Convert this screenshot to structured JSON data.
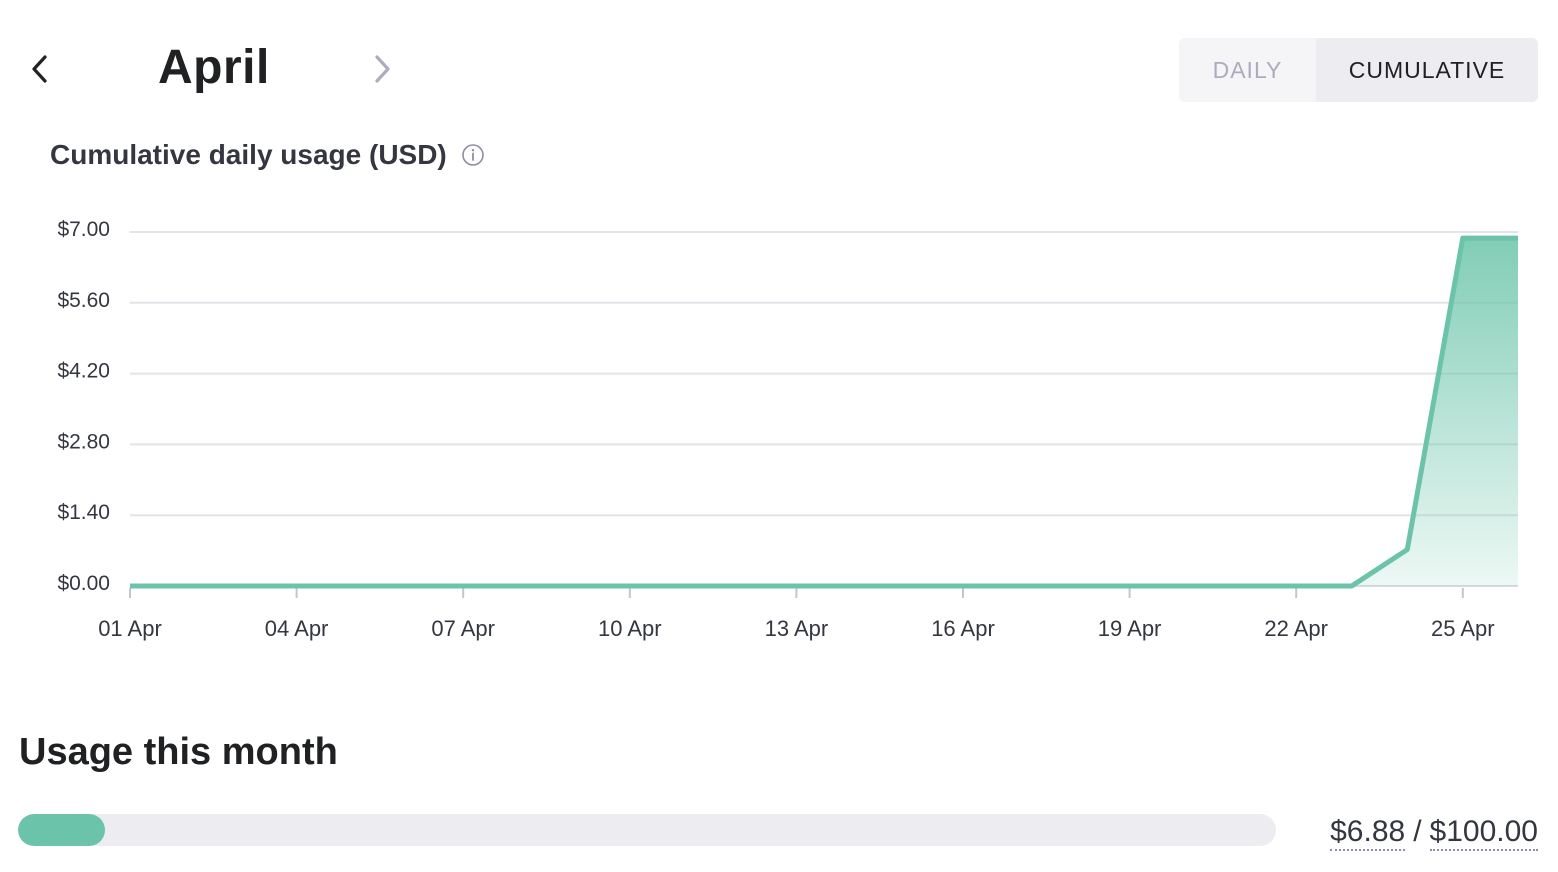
{
  "header": {
    "month": "April",
    "prev_icon": "chevron-left-icon",
    "next_icon": "chevron-right-icon",
    "toggle": {
      "daily_label": "DAILY",
      "cumulative_label": "CUMULATIVE",
      "selected": "cumulative"
    }
  },
  "chart": {
    "title": "Cumulative daily usage (USD)",
    "info_icon": "info-icon",
    "line_color": "#6bc4a9"
  },
  "chart_data": {
    "type": "area",
    "title": "Cumulative daily usage (USD)",
    "xlabel": "",
    "ylabel": "",
    "x": [
      "01 Apr",
      "02 Apr",
      "03 Apr",
      "04 Apr",
      "05 Apr",
      "06 Apr",
      "07 Apr",
      "08 Apr",
      "09 Apr",
      "10 Apr",
      "11 Apr",
      "12 Apr",
      "13 Apr",
      "14 Apr",
      "15 Apr",
      "16 Apr",
      "17 Apr",
      "18 Apr",
      "19 Apr",
      "20 Apr",
      "21 Apr",
      "22 Apr",
      "23 Apr",
      "24 Apr",
      "25 Apr",
      "26 Apr"
    ],
    "series": [
      {
        "values": [
          0,
          0,
          0,
          0,
          0,
          0,
          0,
          0,
          0,
          0,
          0,
          0,
          0,
          0,
          0,
          0,
          0,
          0,
          0,
          0,
          0,
          0,
          0,
          0.72,
          6.88,
          6.88
        ]
      }
    ],
    "x_tick_labels": [
      "01 Apr",
      "04 Apr",
      "07 Apr",
      "10 Apr",
      "13 Apr",
      "16 Apr",
      "19 Apr",
      "22 Apr",
      "25 Apr"
    ],
    "y_tick_labels": [
      "$0.00",
      "$1.40",
      "$2.80",
      "$4.20",
      "$5.60",
      "$7.00"
    ],
    "y_ticks": [
      0,
      1.4,
      2.8,
      4.2,
      5.6,
      7.0
    ],
    "ylim": [
      0,
      7.0
    ],
    "grid": true
  },
  "usage": {
    "title": "Usage this month",
    "used": "$6.88",
    "separator": "/",
    "limit": "$100.00",
    "fraction": 0.0688,
    "bar_color": "#6bc4a9"
  }
}
